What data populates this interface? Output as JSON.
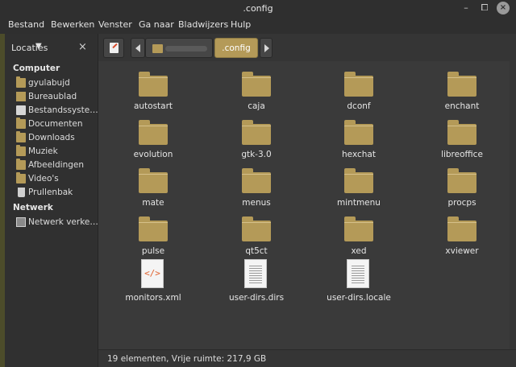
{
  "window": {
    "title": ".config",
    "minimize": "–",
    "maximize": "⧠",
    "close": "×"
  },
  "menu": [
    "Bestand",
    "Bewerken",
    "Venster",
    "Ga naar",
    "Bladwijzers",
    "Hulp"
  ],
  "sidebar": {
    "selector_label": "Locaties",
    "chevron": "▼",
    "close": "×",
    "sections": [
      {
        "title": "Computer",
        "items": [
          {
            "label": "gyulabujd",
            "icon": "home-folder-icon"
          },
          {
            "label": "Bureaublad",
            "icon": "desktop-icon"
          },
          {
            "label": "Bestandssyste…",
            "icon": "drive-icon"
          },
          {
            "label": "Documenten",
            "icon": "folder-icon"
          },
          {
            "label": "Downloads",
            "icon": "folder-icon"
          },
          {
            "label": "Muziek",
            "icon": "folder-icon"
          },
          {
            "label": "Afbeeldingen",
            "icon": "folder-icon"
          },
          {
            "label": "Video's",
            "icon": "folder-icon"
          },
          {
            "label": "Prullenbak",
            "icon": "trash-icon"
          }
        ]
      },
      {
        "title": "Netwerk",
        "items": [
          {
            "label": "Netwerk verke…",
            "icon": "network-icon"
          }
        ]
      }
    ]
  },
  "toolbar": {
    "current_folder": ".config"
  },
  "files": [
    {
      "name": "autostart",
      "type": "folder"
    },
    {
      "name": "caja",
      "type": "folder"
    },
    {
      "name": "dconf",
      "type": "folder"
    },
    {
      "name": "enchant",
      "type": "folder"
    },
    {
      "name": "evolution",
      "type": "folder"
    },
    {
      "name": "gtk-3.0",
      "type": "folder"
    },
    {
      "name": "hexchat",
      "type": "folder"
    },
    {
      "name": "libreoffice",
      "type": "folder"
    },
    {
      "name": "mate",
      "type": "folder"
    },
    {
      "name": "menus",
      "type": "folder"
    },
    {
      "name": "mintmenu",
      "type": "folder"
    },
    {
      "name": "procps",
      "type": "folder"
    },
    {
      "name": "pulse",
      "type": "folder"
    },
    {
      "name": "qt5ct",
      "type": "folder"
    },
    {
      "name": "xed",
      "type": "folder"
    },
    {
      "name": "xviewer",
      "type": "folder"
    },
    {
      "name": "monitors.xml",
      "type": "xml",
      "glyph": "</>"
    },
    {
      "name": "user-dirs.dirs",
      "type": "text"
    },
    {
      "name": "user-dirs.locale",
      "type": "text"
    }
  ],
  "status": {
    "text": "19 elementen, Vrije ruimte: 217,9 GB"
  },
  "colors": {
    "folder": "#b49a58",
    "accent": "#b49a58",
    "background": "#3a3a3a"
  }
}
